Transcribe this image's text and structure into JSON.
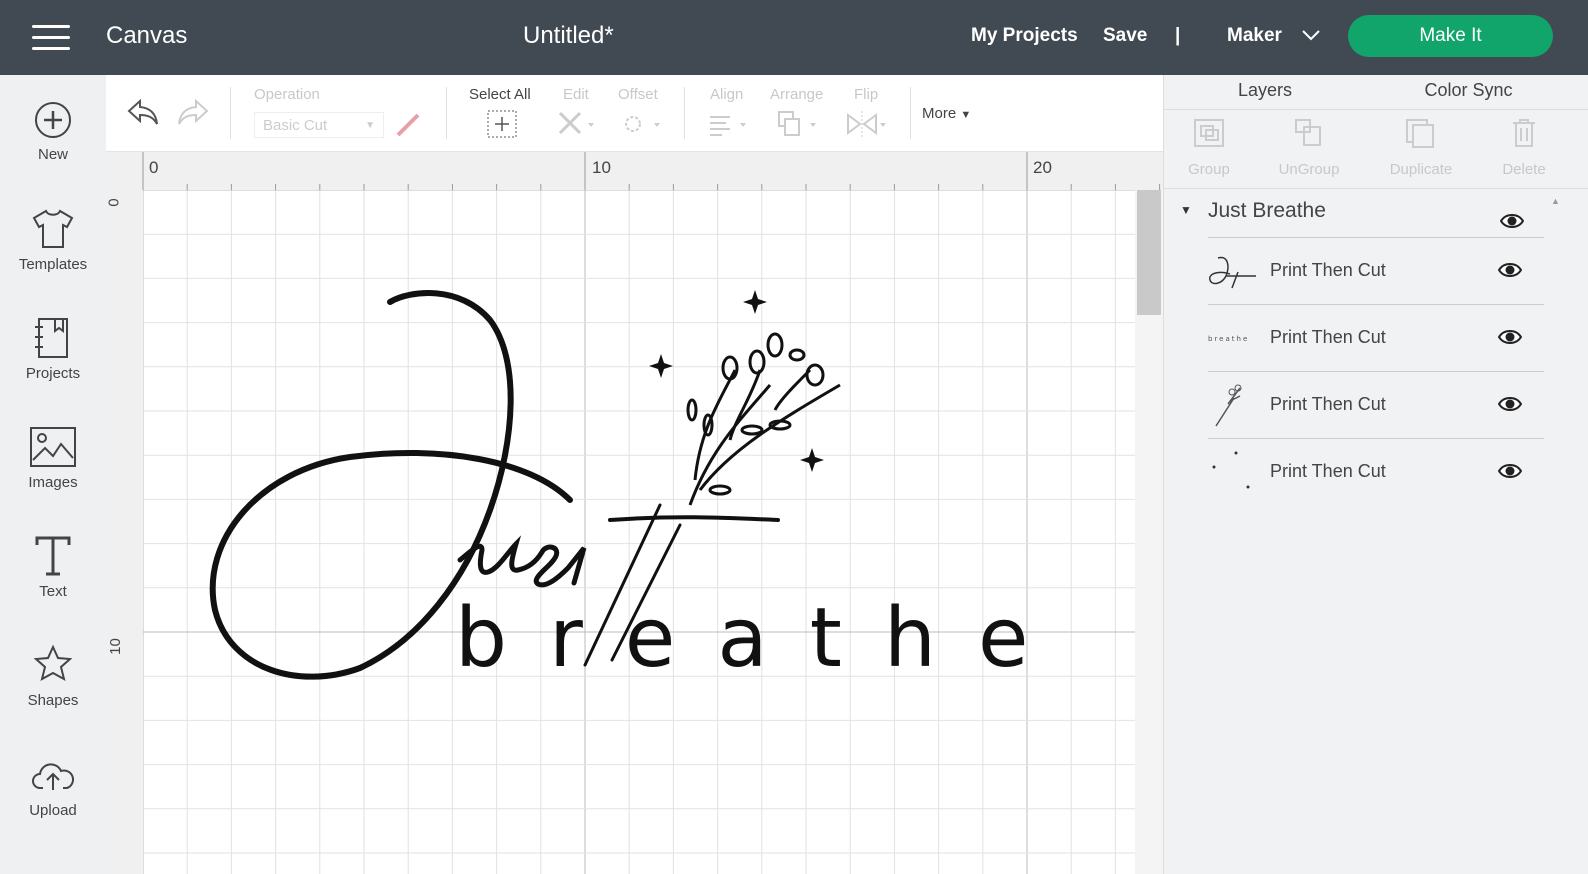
{
  "header": {
    "app_name": "Canvas",
    "doc_title": "Untitled*",
    "my_projects": "My Projects",
    "save": "Save",
    "separator": "|",
    "machine": "Maker",
    "make_it": "Make It",
    "colors": {
      "bar": "#414a53",
      "make_it": "#12a56b"
    }
  },
  "sidebar": {
    "items": [
      {
        "label": "New",
        "icon": "plus-circle-icon"
      },
      {
        "label": "Templates",
        "icon": "tshirt-icon"
      },
      {
        "label": "Projects",
        "icon": "notebook-icon"
      },
      {
        "label": "Images",
        "icon": "image-icon"
      },
      {
        "label": "Text",
        "icon": "text-icon"
      },
      {
        "label": "Shapes",
        "icon": "shapes-icon"
      },
      {
        "label": "Upload",
        "icon": "cloud-upload-icon"
      }
    ]
  },
  "toolbar": {
    "operation": "Operation",
    "operation_value": "Basic Cut",
    "select_all": "Select All",
    "edit": "Edit",
    "offset": "Offset",
    "align": "Align",
    "arrange": "Arrange",
    "flip": "Flip",
    "more": "More"
  },
  "rulers": {
    "h": [
      "0",
      "10",
      "20"
    ],
    "v": [
      "0",
      "10"
    ]
  },
  "artwork": {
    "script": "Just",
    "text": "b r e a t h e"
  },
  "panel": {
    "tabs": [
      "Layers",
      "Color Sync"
    ],
    "tools": [
      "Group",
      "UnGroup",
      "Duplicate",
      "Delete"
    ],
    "group": "Just Breathe",
    "layers": [
      {
        "label": "Print Then Cut",
        "thumb": "Just"
      },
      {
        "label": "Print Then Cut",
        "thumb": "breathe"
      },
      {
        "label": "Print Then Cut",
        "thumb": "flowers"
      },
      {
        "label": "Print Then Cut",
        "thumb": "stars"
      }
    ]
  }
}
